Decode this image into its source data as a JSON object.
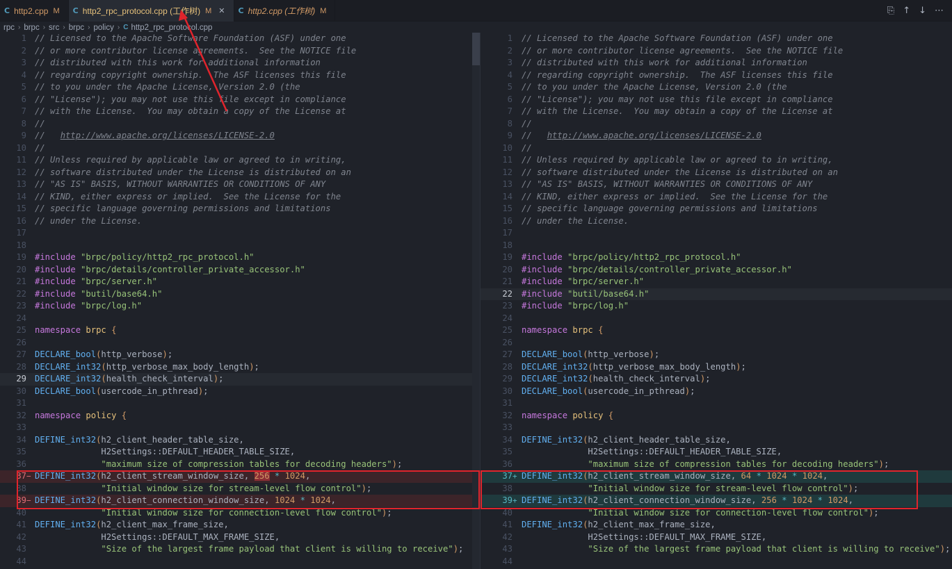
{
  "tabs": [
    {
      "icon": "C",
      "label": "http2.cpp",
      "mod": "M",
      "active": false,
      "italic": false
    },
    {
      "icon": "C",
      "label": "http2_rpc_protocol.cpp (工作树)",
      "mod": "M",
      "active": true,
      "italic": false,
      "close": "✕"
    },
    {
      "icon": "C",
      "label": "http2.cpp (工作树)",
      "mod": "M",
      "active": false,
      "italic": true
    }
  ],
  "breadcrumb": [
    "rpc",
    "brpc",
    "src",
    "brpc",
    "policy",
    "http2_rpc_protocol.cpp"
  ],
  "breadcrumb_sep": "›",
  "toolbar_icons": [
    "open-changes-icon",
    "arrow-up-icon",
    "arrow-down-icon",
    "more-icon"
  ],
  "toolbar_glyphs": [
    "⎘",
    "↑",
    "↓",
    "⋯"
  ],
  "colors": {
    "deleted_bg": "#3c2429",
    "added_bg": "#1f3a3d",
    "annotation": "#e0242c"
  },
  "left": {
    "current_line": 29,
    "lines": [
      [
        {
          "t": "cmt",
          "v": "// Licensed to the Apache Software Foundation (ASF) under one"
        }
      ],
      [
        {
          "t": "cmt",
          "v": "// or more contributor license agreements.  See the NOTICE file"
        }
      ],
      [
        {
          "t": "cmt",
          "v": "// distributed with this work for additional information"
        }
      ],
      [
        {
          "t": "cmt",
          "v": "// regarding copyright ownership.  The ASF licenses this file"
        }
      ],
      [
        {
          "t": "cmt",
          "v": "// to you under the Apache License, Version 2.0 (the"
        }
      ],
      [
        {
          "t": "cmt",
          "v": "// \"License\"); you may not use this file except in compliance"
        }
      ],
      [
        {
          "t": "cmt",
          "v": "// with the License.  You may obtain a copy of the License at"
        }
      ],
      [
        {
          "t": "cmt",
          "v": "//"
        }
      ],
      [
        {
          "t": "cmt",
          "v": "//   "
        },
        {
          "t": "url",
          "v": "http://www.apache.org/licenses/LICENSE-2.0"
        }
      ],
      [
        {
          "t": "cmt",
          "v": "//"
        }
      ],
      [
        {
          "t": "cmt",
          "v": "// Unless required by applicable law or agreed to in writing,"
        }
      ],
      [
        {
          "t": "cmt",
          "v": "// software distributed under the License is distributed on an"
        }
      ],
      [
        {
          "t": "cmt",
          "v": "// \"AS IS\" BASIS, WITHOUT WARRANTIES OR CONDITIONS OF ANY"
        }
      ],
      [
        {
          "t": "cmt",
          "v": "// KIND, either express or implied.  See the License for the"
        }
      ],
      [
        {
          "t": "cmt",
          "v": "// specific language governing permissions and limitations"
        }
      ],
      [
        {
          "t": "cmt",
          "v": "// under the License."
        }
      ],
      [],
      [],
      [
        {
          "t": "kw",
          "v": "#include"
        },
        {
          "t": "id",
          "v": " "
        },
        {
          "t": "str",
          "v": "\"brpc/policy/http2_rpc_protocol.h\""
        }
      ],
      [
        {
          "t": "kw",
          "v": "#include"
        },
        {
          "t": "id",
          "v": " "
        },
        {
          "t": "str",
          "v": "\"brpc/details/controller_private_accessor.h\""
        }
      ],
      [
        {
          "t": "kw",
          "v": "#include"
        },
        {
          "t": "id",
          "v": " "
        },
        {
          "t": "str",
          "v": "\"brpc/server.h\""
        }
      ],
      [
        {
          "t": "kw",
          "v": "#include"
        },
        {
          "t": "id",
          "v": " "
        },
        {
          "t": "str",
          "v": "\"butil/base64.h\""
        }
      ],
      [
        {
          "t": "kw",
          "v": "#include"
        },
        {
          "t": "id",
          "v": " "
        },
        {
          "t": "str",
          "v": "\"brpc/log.h\""
        }
      ],
      [],
      [
        {
          "t": "kw",
          "v": "namespace"
        },
        {
          "t": "id",
          "v": " "
        },
        {
          "t": "ns",
          "v": "brpc"
        },
        {
          "t": "id",
          "v": " "
        },
        {
          "t": "num",
          "v": "{"
        }
      ],
      [],
      [
        {
          "t": "fn",
          "v": "DECLARE_bool"
        },
        {
          "t": "num",
          "v": "("
        },
        {
          "t": "id",
          "v": "http_verbose"
        },
        {
          "t": "num",
          "v": ")"
        },
        {
          "t": "id",
          "v": ";"
        }
      ],
      [
        {
          "t": "fn",
          "v": "DECLARE_int32"
        },
        {
          "t": "num",
          "v": "("
        },
        {
          "t": "id",
          "v": "http_verbose_max_body_length"
        },
        {
          "t": "num",
          "v": ")"
        },
        {
          "t": "id",
          "v": ";"
        }
      ],
      [
        {
          "t": "fn",
          "v": "DECLARE_int32"
        },
        {
          "t": "num",
          "v": "("
        },
        {
          "t": "id",
          "v": "health_check_interval"
        },
        {
          "t": "num",
          "v": ")"
        },
        {
          "t": "id",
          "v": ";"
        }
      ],
      [
        {
          "t": "fn",
          "v": "DECLARE_bool"
        },
        {
          "t": "num",
          "v": "("
        },
        {
          "t": "id",
          "v": "usercode_in_pthread"
        },
        {
          "t": "num",
          "v": ")"
        },
        {
          "t": "id",
          "v": ";"
        }
      ],
      [],
      [
        {
          "t": "kw",
          "v": "namespace"
        },
        {
          "t": "id",
          "v": " "
        },
        {
          "t": "ns",
          "v": "policy"
        },
        {
          "t": "id",
          "v": " "
        },
        {
          "t": "num",
          "v": "{"
        }
      ],
      [],
      [
        {
          "t": "fn",
          "v": "DEFINE_int32"
        },
        {
          "t": "num",
          "v": "("
        },
        {
          "t": "id",
          "v": "h2_client_header_table_size,"
        }
      ],
      [
        {
          "t": "id",
          "v": "             H2Settings::DEFAULT_HEADER_TABLE_SIZE,"
        }
      ],
      [
        {
          "t": "id",
          "v": "             "
        },
        {
          "t": "str",
          "v": "\"maximum size of compression tables for decoding headers\""
        },
        {
          "t": "num",
          "v": ")"
        },
        {
          "t": "id",
          "v": ";"
        }
      ],
      [
        {
          "t": "fn",
          "v": "DEFINE_int32"
        },
        {
          "t": "num",
          "v": "("
        },
        {
          "t": "id",
          "v": "h2_client_stream_window_size, "
        },
        {
          "t": "numhl",
          "v": "256"
        },
        {
          "t": "id",
          "v": " "
        },
        {
          "t": "op",
          "v": "*"
        },
        {
          "t": "id",
          "v": " "
        },
        {
          "t": "num",
          "v": "1024"
        },
        {
          "t": "id",
          "v": ","
        }
      ],
      [
        {
          "t": "id",
          "v": "             "
        },
        {
          "t": "str",
          "v": "\"Initial window size for stream-level flow control\""
        },
        {
          "t": "num",
          "v": ")"
        },
        {
          "t": "id",
          "v": ";"
        }
      ],
      [
        {
          "t": "fn",
          "v": "DEFINE_int32"
        },
        {
          "t": "num",
          "v": "("
        },
        {
          "t": "id",
          "v": "h2_client_connection_window_size, "
        },
        {
          "t": "num",
          "v": "1024"
        },
        {
          "t": "id",
          "v": " "
        },
        {
          "t": "op",
          "v": "*"
        },
        {
          "t": "id",
          "v": " "
        },
        {
          "t": "num",
          "v": "1024"
        },
        {
          "t": "id",
          "v": ","
        }
      ],
      [
        {
          "t": "id",
          "v": "             "
        },
        {
          "t": "str",
          "v": "\"Initial window size for connection-level flow control\""
        },
        {
          "t": "num",
          "v": ")"
        },
        {
          "t": "id",
          "v": ";"
        }
      ],
      [
        {
          "t": "fn",
          "v": "DEFINE_int32"
        },
        {
          "t": "num",
          "v": "("
        },
        {
          "t": "id",
          "v": "h2_client_max_frame_size,"
        }
      ],
      [
        {
          "t": "id",
          "v": "             H2Settings::DEFAULT_MAX_FRAME_SIZE,"
        }
      ],
      [
        {
          "t": "id",
          "v": "             "
        },
        {
          "t": "str",
          "v": "\"Size of the largest frame payload that client is willing to receive\""
        },
        {
          "t": "num",
          "v": ")"
        },
        {
          "t": "id",
          "v": ";"
        }
      ],
      []
    ],
    "deleted": [
      37,
      39
    ]
  },
  "right": {
    "current_line": 22,
    "lines": [
      [
        {
          "t": "cmt",
          "v": "// Licensed to the Apache Software Foundation (ASF) under one"
        }
      ],
      [
        {
          "t": "cmt",
          "v": "// or more contributor license agreements.  See the NOTICE file"
        }
      ],
      [
        {
          "t": "cmt",
          "v": "// distributed with this work for additional information"
        }
      ],
      [
        {
          "t": "cmt",
          "v": "// regarding copyright ownership.  The ASF licenses this file"
        }
      ],
      [
        {
          "t": "cmt",
          "v": "// to you under the Apache License, Version 2.0 (the"
        }
      ],
      [
        {
          "t": "cmt",
          "v": "// \"License\"); you may not use this file except in compliance"
        }
      ],
      [
        {
          "t": "cmt",
          "v": "// with the License.  You may obtain a copy of the License at"
        }
      ],
      [
        {
          "t": "cmt",
          "v": "//"
        }
      ],
      [
        {
          "t": "cmt",
          "v": "//   "
        },
        {
          "t": "url",
          "v": "http://www.apache.org/licenses/LICENSE-2.0"
        }
      ],
      [
        {
          "t": "cmt",
          "v": "//"
        }
      ],
      [
        {
          "t": "cmt",
          "v": "// Unless required by applicable law or agreed to in writing,"
        }
      ],
      [
        {
          "t": "cmt",
          "v": "// software distributed under the License is distributed on an"
        }
      ],
      [
        {
          "t": "cmt",
          "v": "// \"AS IS\" BASIS, WITHOUT WARRANTIES OR CONDITIONS OF ANY"
        }
      ],
      [
        {
          "t": "cmt",
          "v": "// KIND, either express or implied.  See the License for the"
        }
      ],
      [
        {
          "t": "cmt",
          "v": "// specific language governing permissions and limitations"
        }
      ],
      [
        {
          "t": "cmt",
          "v": "// under the License."
        }
      ],
      [],
      [],
      [
        {
          "t": "kw",
          "v": "#include"
        },
        {
          "t": "id",
          "v": " "
        },
        {
          "t": "str",
          "v": "\"brpc/policy/http2_rpc_protocol.h\""
        }
      ],
      [
        {
          "t": "kw",
          "v": "#include"
        },
        {
          "t": "id",
          "v": " "
        },
        {
          "t": "str",
          "v": "\"brpc/details/controller_private_accessor.h\""
        }
      ],
      [
        {
          "t": "kw",
          "v": "#include"
        },
        {
          "t": "id",
          "v": " "
        },
        {
          "t": "str",
          "v": "\"brpc/server.h\""
        }
      ],
      [
        {
          "t": "kw",
          "v": "#include"
        },
        {
          "t": "id",
          "v": " "
        },
        {
          "t": "str",
          "v": "\"butil/base64.h\""
        }
      ],
      [
        {
          "t": "kw",
          "v": "#include"
        },
        {
          "t": "id",
          "v": " "
        },
        {
          "t": "str",
          "v": "\"brpc/log.h\""
        }
      ],
      [],
      [
        {
          "t": "kw",
          "v": "namespace"
        },
        {
          "t": "id",
          "v": " "
        },
        {
          "t": "ns",
          "v": "brpc"
        },
        {
          "t": "id",
          "v": " "
        },
        {
          "t": "num",
          "v": "{"
        }
      ],
      [],
      [
        {
          "t": "fn",
          "v": "DECLARE_bool"
        },
        {
          "t": "num",
          "v": "("
        },
        {
          "t": "id",
          "v": "http_verbose"
        },
        {
          "t": "num",
          "v": ")"
        },
        {
          "t": "id",
          "v": ";"
        }
      ],
      [
        {
          "t": "fn",
          "v": "DECLARE_int32"
        },
        {
          "t": "num",
          "v": "("
        },
        {
          "t": "id",
          "v": "http_verbose_max_body_length"
        },
        {
          "t": "num",
          "v": ")"
        },
        {
          "t": "id",
          "v": ";"
        }
      ],
      [
        {
          "t": "fn",
          "v": "DECLARE_int32"
        },
        {
          "t": "num",
          "v": "("
        },
        {
          "t": "id",
          "v": "health_check_interval"
        },
        {
          "t": "num",
          "v": ")"
        },
        {
          "t": "id",
          "v": ";"
        }
      ],
      [
        {
          "t": "fn",
          "v": "DECLARE_bool"
        },
        {
          "t": "num",
          "v": "("
        },
        {
          "t": "id",
          "v": "usercode_in_pthread"
        },
        {
          "t": "num",
          "v": ")"
        },
        {
          "t": "id",
          "v": ";"
        }
      ],
      [],
      [
        {
          "t": "kw",
          "v": "namespace"
        },
        {
          "t": "id",
          "v": " "
        },
        {
          "t": "ns",
          "v": "policy"
        },
        {
          "t": "id",
          "v": " "
        },
        {
          "t": "num",
          "v": "{"
        }
      ],
      [],
      [
        {
          "t": "fn",
          "v": "DEFINE_int32"
        },
        {
          "t": "num",
          "v": "("
        },
        {
          "t": "id",
          "v": "h2_client_header_table_size,"
        }
      ],
      [
        {
          "t": "id",
          "v": "             H2Settings::DEFAULT_HEADER_TABLE_SIZE,"
        }
      ],
      [
        {
          "t": "id",
          "v": "             "
        },
        {
          "t": "str",
          "v": "\"maximum size of compression tables for decoding headers\""
        },
        {
          "t": "num",
          "v": ")"
        },
        {
          "t": "id",
          "v": ";"
        }
      ],
      [
        {
          "t": "fn",
          "v": "DEFINE_int32"
        },
        {
          "t": "num",
          "v": "("
        },
        {
          "t": "id",
          "v": "h2_client_stream_window_size, "
        },
        {
          "t": "num",
          "v": "64"
        },
        {
          "t": "id",
          "v": " "
        },
        {
          "t": "op",
          "v": "*"
        },
        {
          "t": "id",
          "v": " "
        },
        {
          "t": "num",
          "v": "1024"
        },
        {
          "t": "id",
          "v": " "
        },
        {
          "t": "op",
          "v": "*"
        },
        {
          "t": "id",
          "v": " "
        },
        {
          "t": "num",
          "v": "1024"
        },
        {
          "t": "id",
          "v": ","
        }
      ],
      [
        {
          "t": "id",
          "v": "             "
        },
        {
          "t": "str",
          "v": "\"Initial window size for stream-level flow control\""
        },
        {
          "t": "num",
          "v": ")"
        },
        {
          "t": "id",
          "v": ";"
        }
      ],
      [
        {
          "t": "fn",
          "v": "DEFINE_int32"
        },
        {
          "t": "num",
          "v": "("
        },
        {
          "t": "id",
          "v": "h2_client_connection_window_size, "
        },
        {
          "t": "num",
          "v": "256"
        },
        {
          "t": "id",
          "v": " "
        },
        {
          "t": "op",
          "v": "*"
        },
        {
          "t": "id",
          "v": " "
        },
        {
          "t": "num",
          "v": "1024"
        },
        {
          "t": "id",
          "v": " "
        },
        {
          "t": "op",
          "v": "*"
        },
        {
          "t": "id",
          "v": " "
        },
        {
          "t": "num",
          "v": "1024"
        },
        {
          "t": "id",
          "v": ","
        }
      ],
      [
        {
          "t": "id",
          "v": "             "
        },
        {
          "t": "str",
          "v": "\"Initial window size for connection-level flow control\""
        },
        {
          "t": "num",
          "v": ")"
        },
        {
          "t": "id",
          "v": ";"
        }
      ],
      [
        {
          "t": "fn",
          "v": "DEFINE_int32"
        },
        {
          "t": "num",
          "v": "("
        },
        {
          "t": "id",
          "v": "h2_client_max_frame_size,"
        }
      ],
      [
        {
          "t": "id",
          "v": "             H2Settings::DEFAULT_MAX_FRAME_SIZE,"
        }
      ],
      [
        {
          "t": "id",
          "v": "             "
        },
        {
          "t": "str",
          "v": "\"Size of the largest frame payload that client is willing to receive\""
        },
        {
          "t": "num",
          "v": ")"
        },
        {
          "t": "id",
          "v": ";"
        }
      ],
      []
    ],
    "added": [
      37,
      39
    ]
  }
}
